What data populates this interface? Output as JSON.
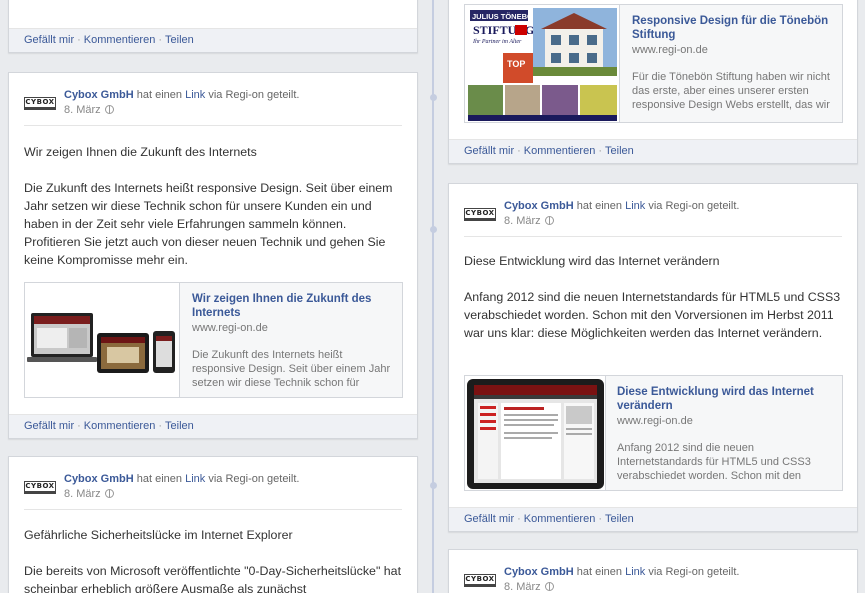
{
  "common": {
    "page_name": "Cybox GmbH",
    "shared_a": "hat einen",
    "link_word": "Link",
    "shared_b": "via Regi-on geteilt.",
    "logo_text": "CYBOX",
    "like": "Gefällt mir",
    "comment": "Kommentieren",
    "share": "Teilen",
    "separator": "·"
  },
  "posts": [
    {
      "date": "8. März",
      "paragraphs": [
        "Wir zeigen Ihnen die Zukunft des Internets",
        "Die Zukunft des Internets heißt responsive Design. Seit über einem Jahr setzen wir diese Technik schon für unsere Kunden ein und haben in der Zeit sehr viele Erfahrungen sammeln können. Profitieren Sie jetzt auch von dieser neuen Technik und gehen Sie keine Kompromisse mehr ein."
      ],
      "link_title": "Wir zeigen Ihnen die Zukunft des Internets",
      "link_url": "www.regi-on.de",
      "link_desc": "Die Zukunft des Internets heißt responsive Design. Seit über einem Jahr setzen wir diese Technik schon für"
    },
    {
      "date": "8. März",
      "paragraphs": [
        "Gefährliche Sicherheitslücke im Internet Explorer",
        "Die bereits von Microsoft veröffentlichte \"0-Day-Sicherheitslücke\" hat scheinbar erheblich größere Ausmaße als zunächst"
      ]
    },
    {
      "link_title": "Responsive Design für die Tönebön Stiftung",
      "link_url": "www.regi-on.de",
      "link_desc": "Für die Tönebön Stiftung haben wir nicht das erste, aber eines unserer ersten responsive Design Webs erstellt, das wir",
      "thumb_sign_line1": "JULIUS TÖNEBÖN",
      "thumb_sign_line2": "STIFTUNG",
      "thumb_sign_line3": "Ihr Partner im Alter",
      "thumb_badge": "TOP"
    },
    {
      "date": "8. März",
      "paragraphs": [
        "Diese Entwicklung wird das Internet verändern",
        "Anfang 2012 sind die neuen Internetstandards für HTML5 und CSS3 verabschiedet worden. Schon mit den Vorversionen im Herbst 2011 war uns klar: diese Möglichkeiten werden das Internet verändern."
      ],
      "link_title": "Diese Entwicklung wird das Internet verändern",
      "link_url": "www.regi-on.de",
      "link_desc": "Anfang 2012 sind die neuen Internetstandards für HTML5 und CSS3 verabschiedet worden. Schon mit den"
    },
    {
      "date": "8. März"
    }
  ],
  "colors": {
    "link_blue": "#3b5998",
    "background": "#e9ebee",
    "spine": "#c5cde0"
  }
}
